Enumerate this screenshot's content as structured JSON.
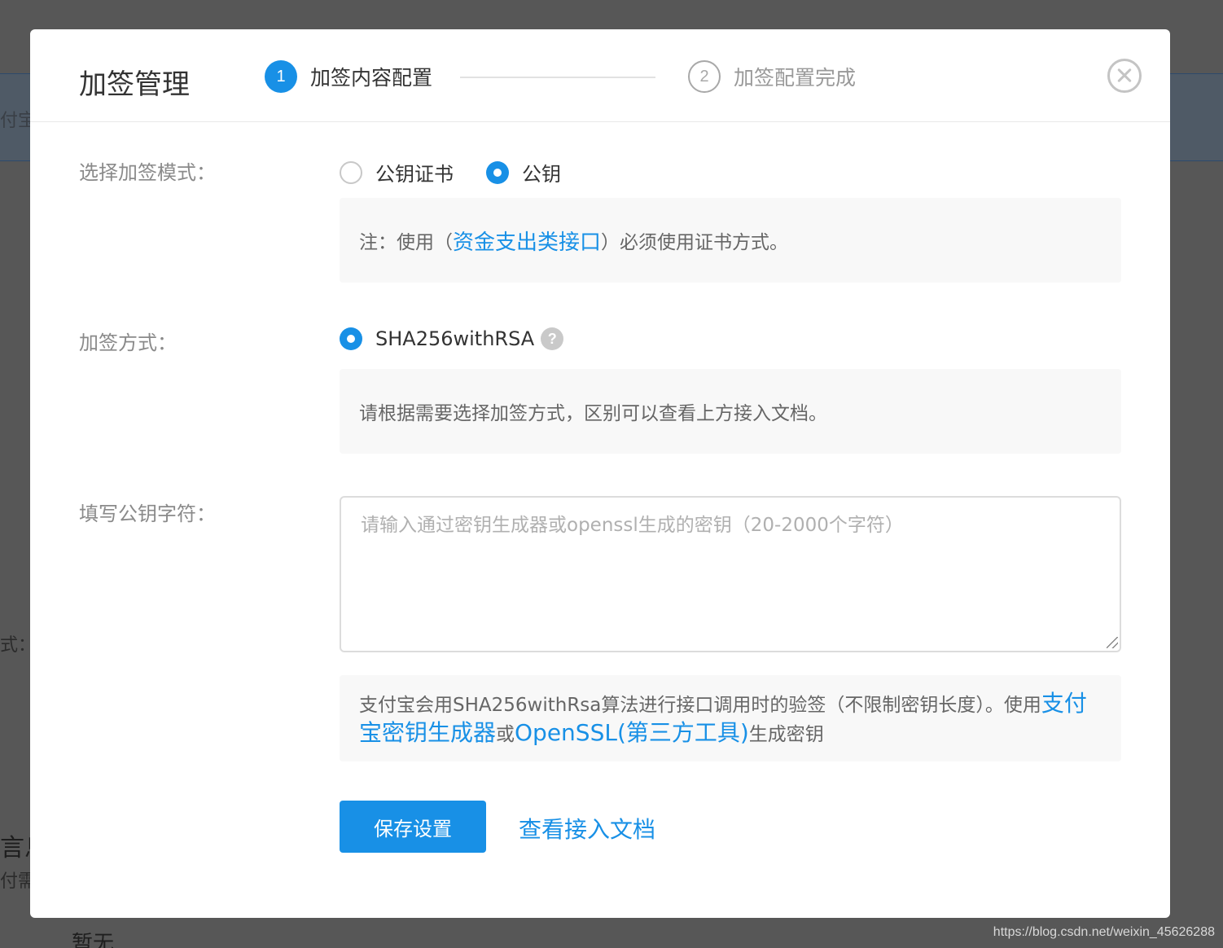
{
  "background": {
    "fragments": [
      "付宝",
      "式：",
      "言息",
      "付需",
      "暂无"
    ]
  },
  "watermark": "https://blog.csdn.net/weixin_45626288",
  "modal": {
    "title": "加签管理",
    "steps": [
      {
        "number": "1",
        "label": "加签内容配置"
      },
      {
        "number": "2",
        "label": "加签配置完成"
      }
    ]
  },
  "form": {
    "mode": {
      "label": "选择加签模式：",
      "options": [
        {
          "label": "公钥证书",
          "selected": false
        },
        {
          "label": "公钥",
          "selected": true
        }
      ],
      "note": {
        "prefix": "注：使用（",
        "link": "资金支出类接口",
        "suffix": "）必须使用证书方式。"
      }
    },
    "method": {
      "label": "加签方式：",
      "option": "SHA256withRSA",
      "help": "?",
      "note": "请根据需要选择加签方式，区别可以查看上方接入文档。"
    },
    "public_key": {
      "label": "填写公钥字符：",
      "placeholder": "请输入通过密钥生成器或openssl生成的密钥（20-2000个字符）",
      "value": "",
      "note": {
        "prefix": "支付宝会用SHA256withRsa算法进行接口调用时的验签（不限制密钥长度）。使用",
        "link1": "支付宝密钥生成器",
        "middle": "或",
        "link2": "OpenSSL(第三方工具)",
        "suffix": "生成密钥"
      }
    }
  },
  "actions": {
    "save": "保存设置",
    "docs": "查看接入文档"
  },
  "colors": {
    "accent": "#1890e6",
    "overlay": "#575757"
  }
}
